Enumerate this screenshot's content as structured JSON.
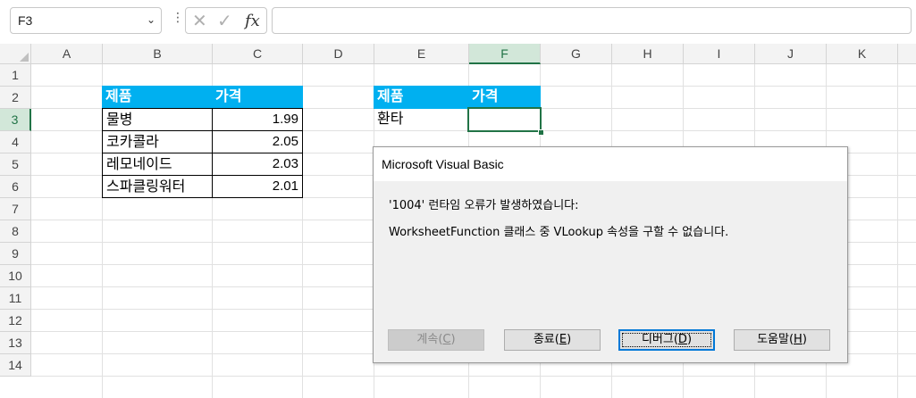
{
  "formula_bar": {
    "name_box": "F3",
    "fx_label": "fx",
    "cancel_glyph": "✕",
    "enter_glyph": "✓",
    "formula": ""
  },
  "grid": {
    "columns": [
      "A",
      "B",
      "C",
      "D",
      "E",
      "F",
      "G",
      "H",
      "I",
      "J",
      "K"
    ],
    "rows": [
      "1",
      "2",
      "3",
      "4",
      "5",
      "6",
      "7",
      "8",
      "9",
      "10",
      "11",
      "12",
      "13",
      "14"
    ],
    "selected_cell": "F3"
  },
  "table1": {
    "header": [
      "제품",
      "가격"
    ],
    "rows": [
      {
        "product": "물병",
        "price": "1.99"
      },
      {
        "product": "코카콜라",
        "price": "2.05"
      },
      {
        "product": "레모네이드",
        "price": "2.03"
      },
      {
        "product": "스파클링워터",
        "price": "2.01"
      }
    ],
    "header_color": "#00b0f0"
  },
  "table2": {
    "header": [
      "제품",
      "가격"
    ],
    "product": "환타",
    "price": ""
  },
  "dialog": {
    "title": "Microsoft Visual Basic",
    "message_line1": "'1004' 런타임 오류가 발생하였습니다:",
    "message_line2": "WorksheetFunction 클래스 중 VLookup 속성을 구할 수 없습니다.",
    "buttons": {
      "continue": {
        "text": "계속(",
        "key": "C",
        "end": ")"
      },
      "end": {
        "text": "종료(",
        "key": "E",
        "end": ")"
      },
      "debug": {
        "text": "디버그(",
        "key": "D",
        "end": ")"
      },
      "help": {
        "text": "도움말(",
        "key": "H",
        "end": ")"
      }
    }
  }
}
